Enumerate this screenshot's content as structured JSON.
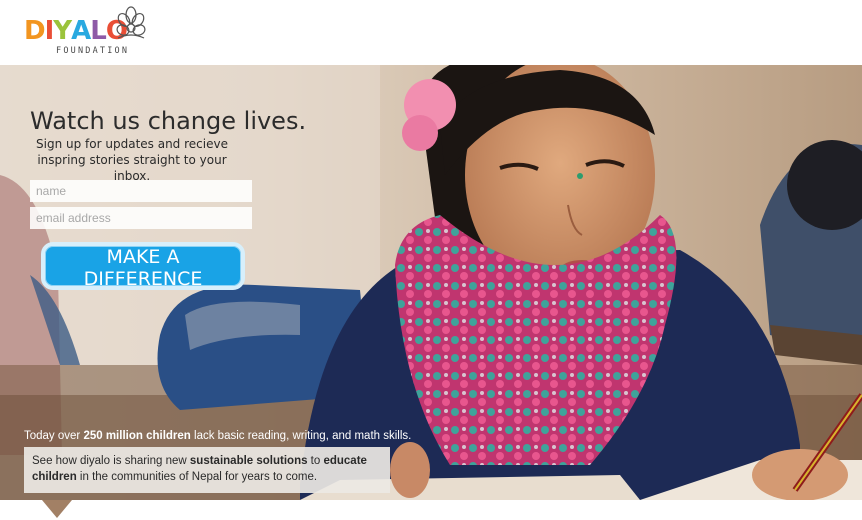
{
  "brand": {
    "logo_word": "DIYALO",
    "logo_sub": "FOUNDATION",
    "logo_colors": [
      "#f29520",
      "#e94e36",
      "#9bc33b",
      "#29a9e0",
      "#8e5aa7",
      "#e94e36"
    ]
  },
  "hero": {
    "headline": "Watch us change lives.",
    "subline": "Sign up for updates and recieve inspring stories straight to your inbox.",
    "name_placeholder": "name",
    "email_placeholder": "email address",
    "cta_label": "MAKE A DIFFERENCE"
  },
  "stats": {
    "prefix": "Today over ",
    "highlight": "250 million children",
    "suffix": " lack basic reading, writing, and math skills."
  },
  "callout": {
    "part1": "See how diyalo is  sharing new ",
    "bold1": "sustainable solutions",
    "part2": " to ",
    "bold2": "educate children",
    "part3": " in the communities of Nepal for years to come."
  },
  "colors": {
    "cta": "#19a3e6",
    "pointer": "#a28065"
  }
}
